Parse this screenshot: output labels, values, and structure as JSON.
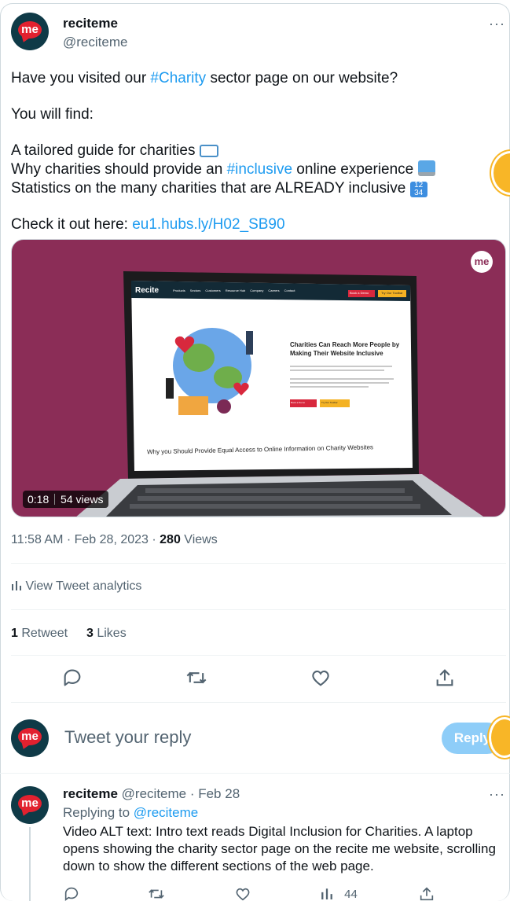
{
  "tweet": {
    "author_name": "reciteme",
    "author_handle": "@reciteme",
    "avatar_text": "me",
    "more": "···",
    "lines": {
      "l1_pre": "Have you visited our ",
      "l1_tag": "#Charity",
      "l1_post": " sector page on our website?",
      "l2": "You will find:",
      "l3": "A tailored guide for charities",
      "l4_pre": "Why charities should provide an ",
      "l4_tag": "#inclusive",
      "l4_post": " online experience",
      "l5": "Statistics on the many charities that are ALREADY inclusive",
      "l6_pre": "Check it out here: ",
      "l6_link": "eu1.hubs.ly/H02_SB90"
    },
    "video": {
      "duration": "0:18",
      "views": "54 views",
      "brand": "me",
      "site_logo": "Recite",
      "nav": [
        "Products",
        "Sectors",
        "Customers",
        "Resource Hub",
        "Company",
        "Careers",
        "Contact"
      ],
      "btn_demo": "Book a Demo",
      "btn_toolbar": "Try Our Toolbar",
      "hero_title": "Charities Can Reach More People by Making Their Website Inclusive",
      "hero_body": "In recent times especially, many people have struggled financially as a result of COVID-19. 51% of high end donors would prefer to give online.",
      "hero_body2": "By attracting a wider audience by making websites accessible to everyone is an excellent way for organisations in the charity sector to be more visible, help more people, recruit more volunteers, and attract donors.",
      "footer_heading": "Why you Should Provide Equal Access to Online Information on Charity Websites"
    },
    "timestamp": "11:58 AM · Feb 28, 2023 · ",
    "views_count": "280",
    "views_label": " Views",
    "analytics": "View Tweet analytics",
    "retweets_count": "1",
    "retweets_label": " Retweet",
    "likes_count": "3",
    "likes_label": " Likes"
  },
  "composer": {
    "placeholder": "Tweet your reply",
    "button": "Reply",
    "avatar_text": "me"
  },
  "reply": {
    "author_name": "reciteme",
    "handle_date": "@reciteme · Feb 28",
    "replying_label": "Replying to ",
    "replying_handle": "@reciteme",
    "text_lines": [
      "Video ALT text: Intro text reads Digital Inclusion for Charities. A laptop",
      "opens showing the charity sector page on the recite me website, scrolling",
      "down to show the different sections of the web page."
    ],
    "analytics_count": "44",
    "more": "···",
    "avatar_text": "me"
  },
  "colors": {
    "accent": "#1d9bf0",
    "brand_dark": "#0f3a47",
    "brand_red": "#e2212f",
    "video_bg": "#8b2d57",
    "reply_button": "#8ecdf8"
  },
  "icons": [
    "reply-icon",
    "retweet-icon",
    "like-icon",
    "share-icon",
    "analytics-icon",
    "book-emoji",
    "computer-emoji",
    "numbers-emoji"
  ]
}
